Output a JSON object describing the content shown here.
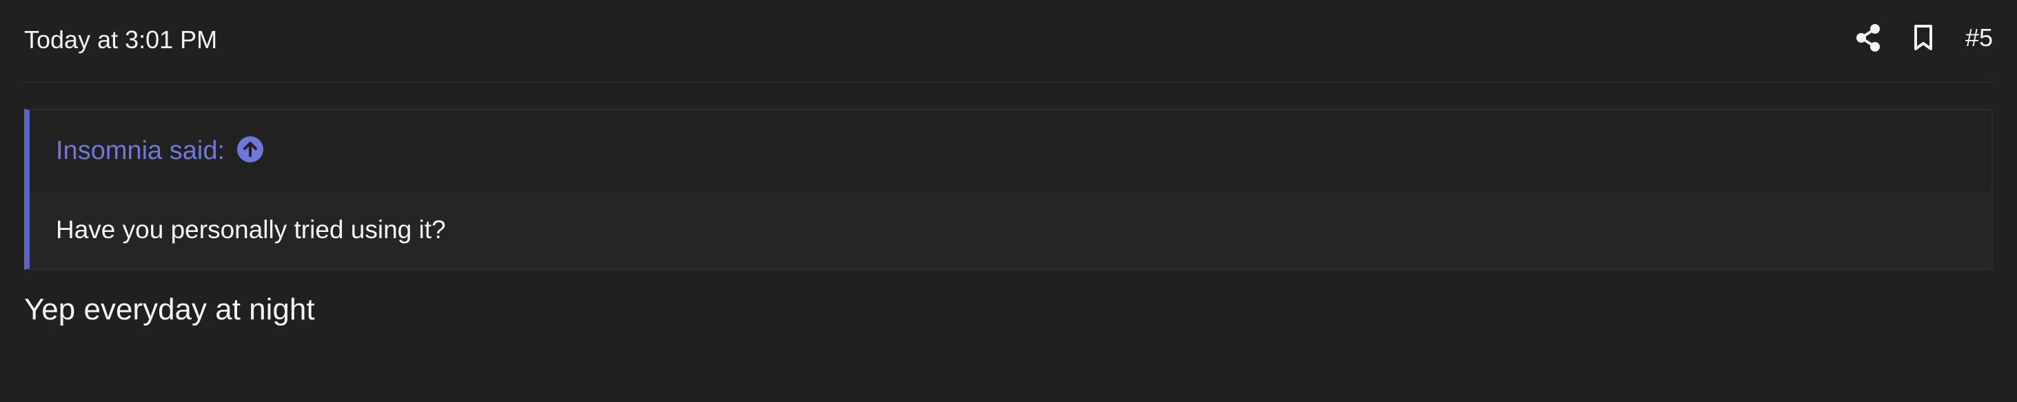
{
  "post": {
    "timestamp": "Today at 3:01 PM",
    "post_number": "#5",
    "quote": {
      "author_label": "Insomnia said:",
      "text": "Have you personally tried using it?"
    },
    "reply_text": "Yep everyday at night"
  },
  "icons": {
    "share": "share-icon",
    "bookmark": "bookmark-icon",
    "jump": "arrow-up-circle-icon"
  },
  "colors": {
    "background": "#202020",
    "accent": "#5c64c7",
    "quote_author": "#6f78d8",
    "text": "#f2f2f2"
  }
}
